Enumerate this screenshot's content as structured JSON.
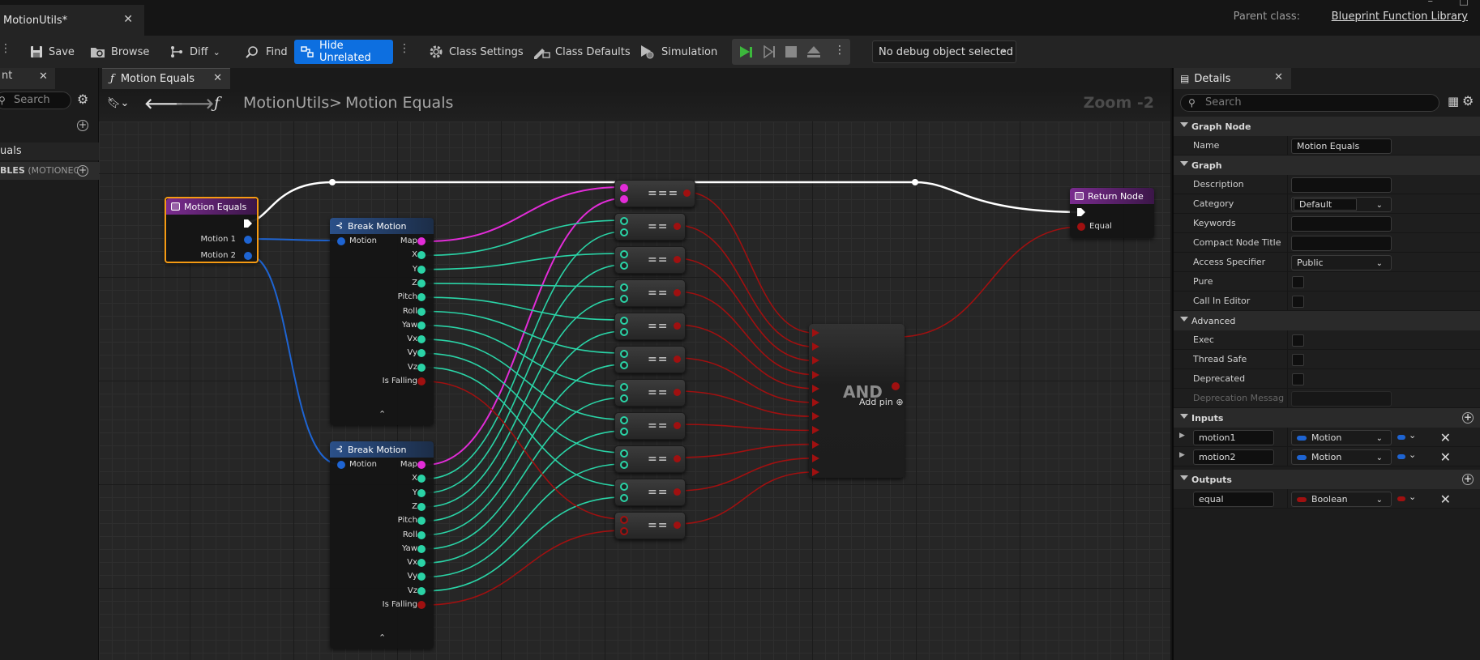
{
  "window": {
    "doc_tab": "MotionUtils*",
    "parent_class_label": "Parent class:",
    "parent_class_value": "Blueprint Function Library"
  },
  "toolbar": {
    "save": "Save",
    "browse": "Browse",
    "diff": "Diff",
    "find": "Find",
    "hide_unrelated": "Hide Unrelated",
    "class_settings": "Class Settings",
    "class_defaults": "Class Defaults",
    "simulation": "Simulation",
    "debug_object": "No debug object selected"
  },
  "left_panel": {
    "tab_label": "nt",
    "search_placeholder": "Search",
    "item1": "uals",
    "item2_prefix": "BLES",
    "item2_suffix": "(MOTIONEQU"
  },
  "graph": {
    "tab_label": "Motion Equals",
    "breadcrumb_parent": "MotionUtils",
    "breadcrumb_sep": ">",
    "breadcrumb_current": "Motion Equals",
    "zoom": "Zoom -2",
    "entry_node": {
      "title": "Motion Equals",
      "pins": [
        "Motion 1",
        "Motion 2"
      ]
    },
    "break_nodes": [
      {
        "title": "Break Motion",
        "input": "Motion",
        "outputs": [
          "Map",
          "X",
          "Y",
          "Z",
          "Pitch",
          "Roll",
          "Yaw",
          "Vx",
          "Vy",
          "Vz",
          "Is Falling"
        ]
      },
      {
        "title": "Break Motion",
        "input": "Motion",
        "outputs": [
          "Map",
          "X",
          "Y",
          "Z",
          "Pitch",
          "Roll",
          "Yaw",
          "Vx",
          "Vy",
          "Vz",
          "Is Falling"
        ]
      }
    ],
    "op_labels": [
      "===",
      "==",
      "==",
      "==",
      "==",
      "==",
      "==",
      "==",
      "==",
      "==",
      "=="
    ],
    "and_node": {
      "label": "AND",
      "add_pin": "Add pin"
    },
    "return_node": {
      "title": "Return Node",
      "pin": "Equal"
    },
    "colors": {
      "exec": "#ffffff",
      "struct": "#1e64d2",
      "map": "#e22cd8",
      "float": "#2ad3a6",
      "bool": "#a01010"
    }
  },
  "details": {
    "tab_label": "Details",
    "search_placeholder": "Search",
    "sections": {
      "graph_node": "Graph Node",
      "graph": "Graph",
      "advanced": "Advanced",
      "inputs": "Inputs",
      "outputs": "Outputs"
    },
    "name_label": "Name",
    "name_value": "Motion Equals",
    "description_label": "Description",
    "category_label": "Category",
    "category_value": "Default",
    "keywords_label": "Keywords",
    "compact_title_label": "Compact Node Title",
    "access_label": "Access Specifier",
    "access_value": "Public",
    "pure_label": "Pure",
    "call_in_editor_label": "Call In Editor",
    "exec_label": "Exec",
    "thread_safe_label": "Thread Safe",
    "deprecated_label": "Deprecated",
    "deprecation_msg_label": "Deprecation Messag",
    "inputs": [
      {
        "name": "motion1",
        "type": "Motion",
        "color": "#1e64d2"
      },
      {
        "name": "motion2",
        "type": "Motion",
        "color": "#1e64d2"
      }
    ],
    "outputs": [
      {
        "name": "equal",
        "type": "Boolean",
        "color": "#a01010"
      }
    ]
  }
}
